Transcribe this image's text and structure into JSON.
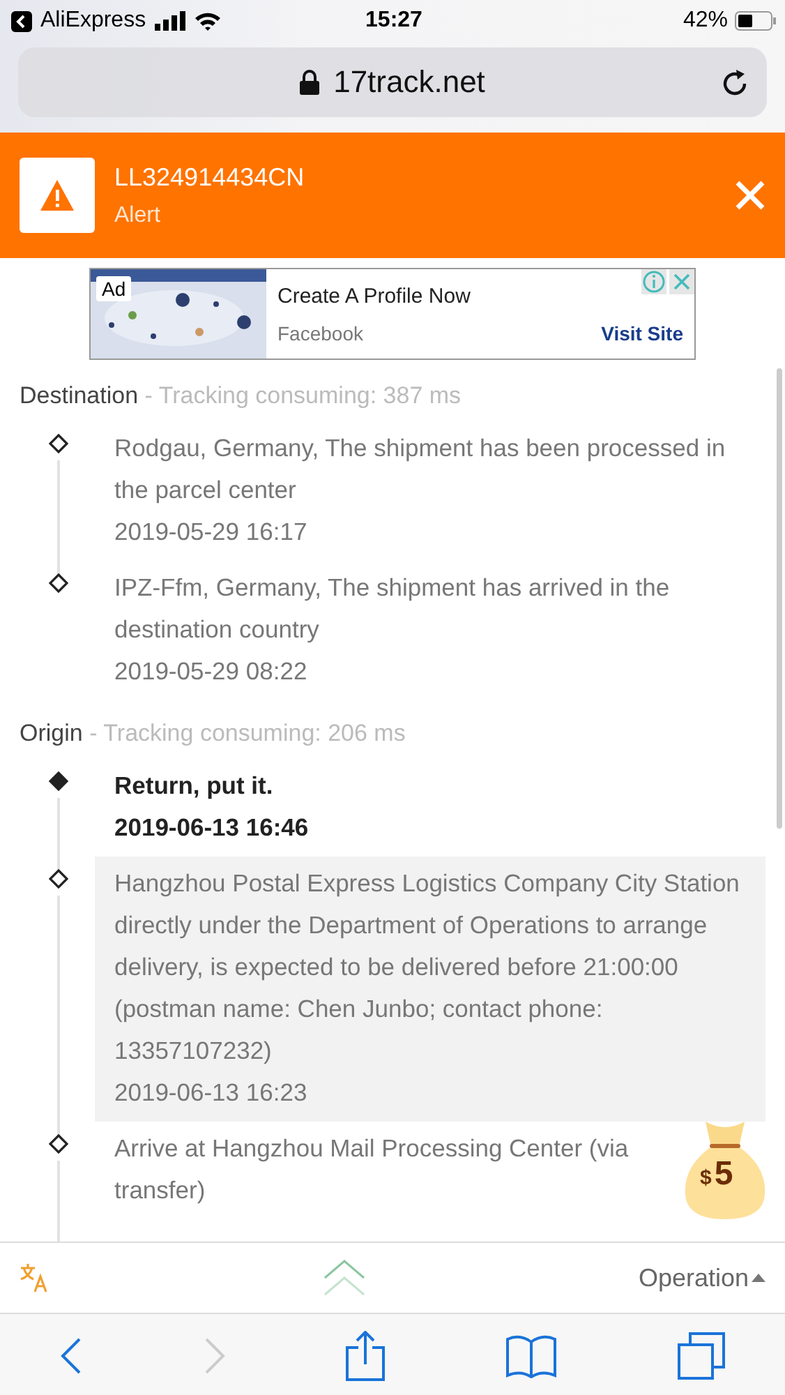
{
  "status_bar": {
    "back_app": "AliExpress",
    "time": "15:27",
    "battery": "42%"
  },
  "url_bar": {
    "domain": "17track.net"
  },
  "header": {
    "tracking_number": "LL324914434CN",
    "status": "Alert"
  },
  "ad": {
    "badge": "Ad",
    "title": "Create A Profile Now",
    "source": "Facebook",
    "action": "Visit Site"
  },
  "sections": [
    {
      "name": "Destination",
      "note": " - Tracking consuming: 387 ms",
      "events": [
        {
          "text": "Rodgau, Germany, The shipment has been processed in the parcel center",
          "time": "2019-05-29 16:17",
          "latest": false,
          "highlighted": false
        },
        {
          "text": "IPZ-Ffm, Germany, The shipment has arrived in the destination country",
          "time": "2019-05-29 08:22",
          "latest": false,
          "highlighted": false
        }
      ]
    },
    {
      "name": "Origin",
      "note": " - Tracking consuming: 206 ms",
      "events": [
        {
          "text": "Return, put it.",
          "time": "2019-06-13 16:46",
          "latest": true,
          "highlighted": false
        },
        {
          "text": "Hangzhou Postal Express Logistics Company City Station directly under the Department of Operations to arrange delivery, is expected to be delivered before 21:00:00 (postman name: Chen Junbo; contact phone: 13357107232)",
          "time": "2019-06-13 16:23",
          "latest": false,
          "highlighted": true
        },
        {
          "text": "Arrive at Hangzhou Mail Processing Center (via transfer)",
          "latest": false,
          "highlighted": false
        }
      ]
    }
  ],
  "bonus": {
    "currency": "$",
    "amount": "5"
  },
  "toolbar": {
    "operation": "Operation"
  }
}
